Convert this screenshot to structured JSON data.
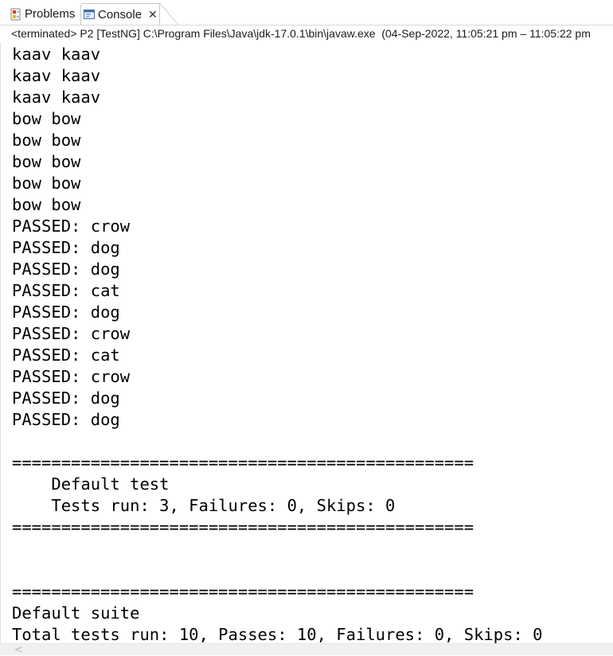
{
  "tabs": [
    {
      "label": "Problems",
      "icon": "problems-icon"
    },
    {
      "label": "Console",
      "icon": "console-icon",
      "active": true,
      "close": "✕"
    }
  ],
  "status": "<terminated> P2 [TestNG] C:\\Program Files\\Java\\jdk-17.0.1\\bin\\javaw.exe  (04-Sep-2022, 11:05:21 pm – 11:05:22 pm",
  "console_lines": [
    "kaav kaav",
    "kaav kaav",
    "kaav kaav",
    "bow bow",
    "bow bow",
    "bow bow",
    "bow bow",
    "bow bow",
    "PASSED: crow",
    "PASSED: dog",
    "PASSED: dog",
    "PASSED: cat",
    "PASSED: dog",
    "PASSED: crow",
    "PASSED: cat",
    "PASSED: crow",
    "PASSED: dog",
    "PASSED: dog",
    "",
    "===============================================",
    "    Default test",
    "    Tests run: 3, Failures: 0, Skips: 0",
    "===============================================",
    "",
    "",
    "===============================================",
    "Default suite",
    "Total tests run: 10, Passes: 10, Failures: 0, Skips: 0"
  ],
  "scrollbar": {
    "left_arrow": "<"
  }
}
